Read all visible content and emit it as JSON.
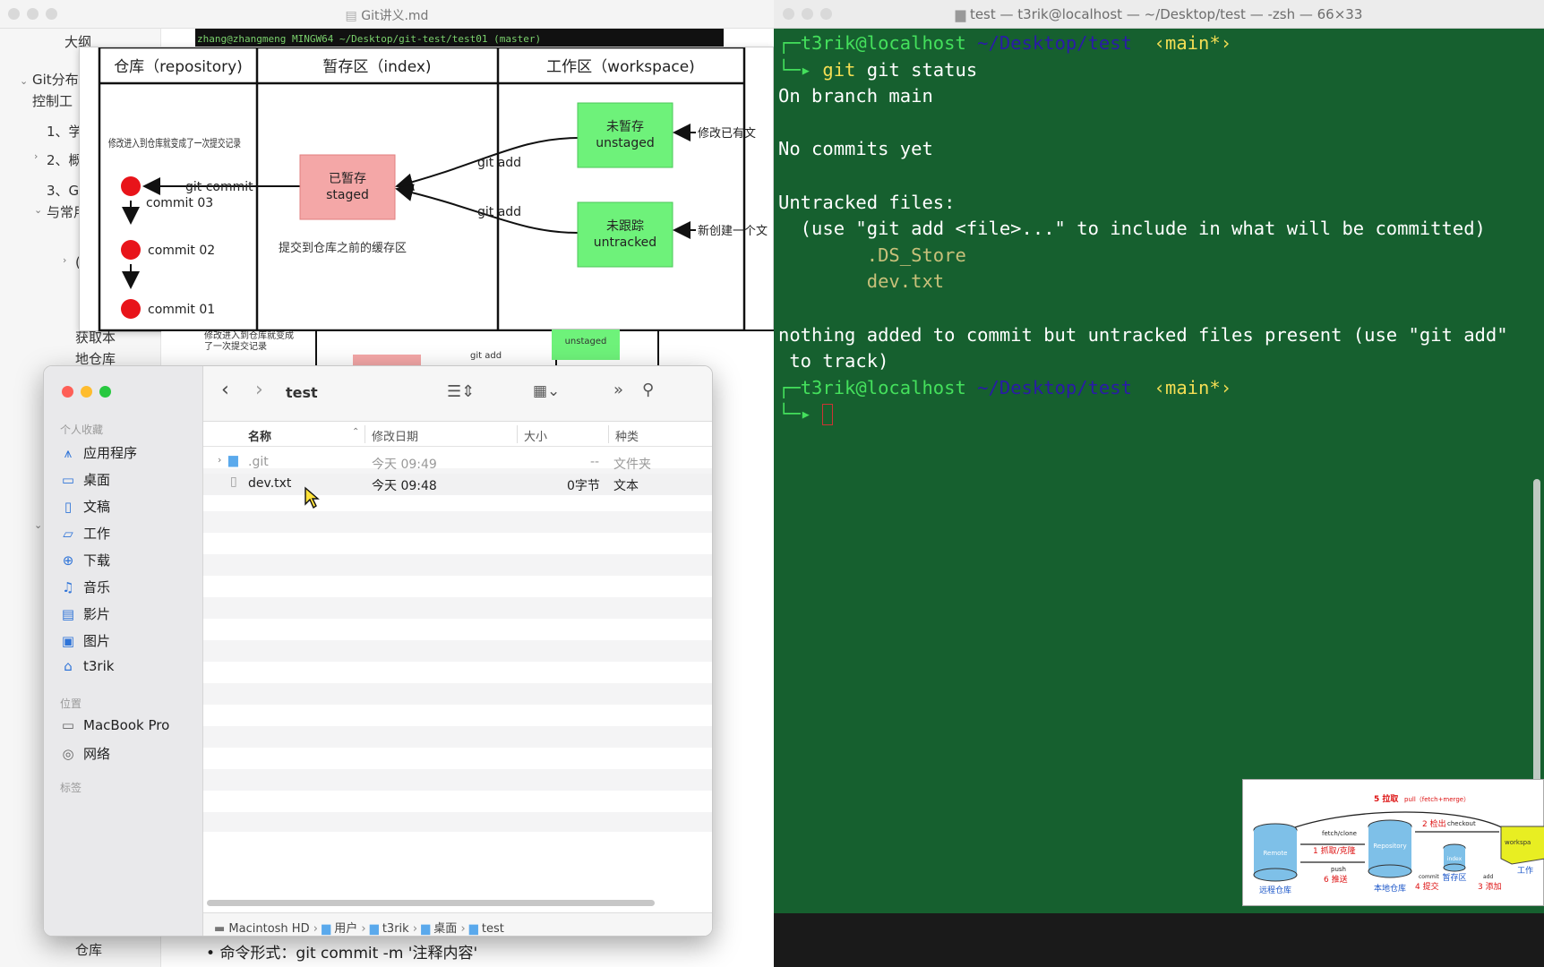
{
  "doc_window": {
    "title": "Git讲义.md",
    "outline": [
      "大纲",
      "Git分布",
      "控制工",
      "1、学",
      "2、概",
      "3、G",
      "与常用",
      "(",
      "获取本",
      "地仓库",
      "仓库"
    ],
    "bullet": "命令形式：git commit -m '注释内容'",
    "mini_bash": "zhang@zhangmeng MINGW64 ~/Desktop/git-test/test01 (master)"
  },
  "diagram": {
    "col_repo": "仓库（repository)",
    "col_index": "暂存区（index)",
    "col_work": "工作区（workspace)",
    "repo_note": "修改进入到仓库就变成了一次提交记录",
    "commits": [
      "commit  03",
      "commit  02",
      "commit  01"
    ],
    "git_commit": "git commit",
    "staged_cn": "已暂存",
    "staged_en": "staged",
    "index_note": "提交到仓库之前的缓存区",
    "git_add_1": "git add",
    "git_add_2": "git add",
    "unstaged_cn": "未暂存",
    "unstaged_en": "unstaged",
    "untracked_cn": "未跟踪",
    "untracked_en": "untracked",
    "modify_note": "修改已有文",
    "new_note": "新创建一个文"
  },
  "under_diagram": {
    "note": "修改进入到仓库就变成了一次提交记录",
    "git_add": "git add",
    "unstaged": "unstaged"
  },
  "finder": {
    "folder": "test",
    "sections": {
      "favorites": "个人收藏",
      "locations": "位置",
      "tags": "标签"
    },
    "favorites": [
      {
        "label": "应用程序",
        "icon": "apps-icon"
      },
      {
        "label": "桌面",
        "icon": "desktop-icon"
      },
      {
        "label": "文稿",
        "icon": "document-icon"
      },
      {
        "label": "工作",
        "icon": "folder-icon"
      },
      {
        "label": "下载",
        "icon": "download-icon"
      },
      {
        "label": "音乐",
        "icon": "music-icon"
      },
      {
        "label": "影片",
        "icon": "movie-icon"
      },
      {
        "label": "图片",
        "icon": "picture-icon"
      },
      {
        "label": "t3rik",
        "icon": "home-icon"
      }
    ],
    "locations": [
      {
        "label": "MacBook Pro",
        "icon": "laptop-icon"
      },
      {
        "label": "网络",
        "icon": "network-icon"
      }
    ],
    "columns": {
      "name": "名称",
      "date": "修改日期",
      "size": "大小",
      "kind": "种类"
    },
    "rows": [
      {
        "name": ".git",
        "date": "今天 09:49",
        "size": "--",
        "kind": "文件夹"
      },
      {
        "name": "dev.txt",
        "date": "今天 09:48",
        "size": "0字节",
        "kind": "文本"
      }
    ],
    "path": [
      "Macintosh HD",
      "用户",
      "t3rik",
      "桌面",
      "test"
    ]
  },
  "terminal": {
    "title": "test — t3rik@localhost — ~/Desktop/test — -zsh — 66×33",
    "user": "t3rik@localhost",
    "cwd": "~/Desktop/test",
    "branch": "‹main*›",
    "command": "git status",
    "lines": [
      "On branch main",
      "",
      "No commits yet",
      "",
      "Untracked files:",
      "  (use \"git add <file>...\" to include in what will be committed)"
    ],
    "files": [
      ".DS_Store",
      "dev.txt"
    ],
    "msg1": "nothing added to commit but untracked files present (use \"git add\"",
    "msg2": " to track)"
  },
  "thumb": {
    "pull": "5 拉取",
    "pull_sub": "pull（fetch+merge）",
    "fetch": "fetch/clone",
    "fetch_cn": "1 抓取/克隆",
    "push": "push",
    "push_cn": "6 推送",
    "checkout": "2 检出",
    "checkout_en": "checkout",
    "commit": "commit",
    "commit_cn": "4 提交",
    "add": "add",
    "add_cn": "3 添加",
    "remote": "Remote",
    "remote_cn": "远程仓库",
    "repo": "Repository",
    "repo_cn": "本地仓库",
    "index": "index",
    "index_cn": "暂存区",
    "workspace": "workspa",
    "work_cn": "工作"
  }
}
